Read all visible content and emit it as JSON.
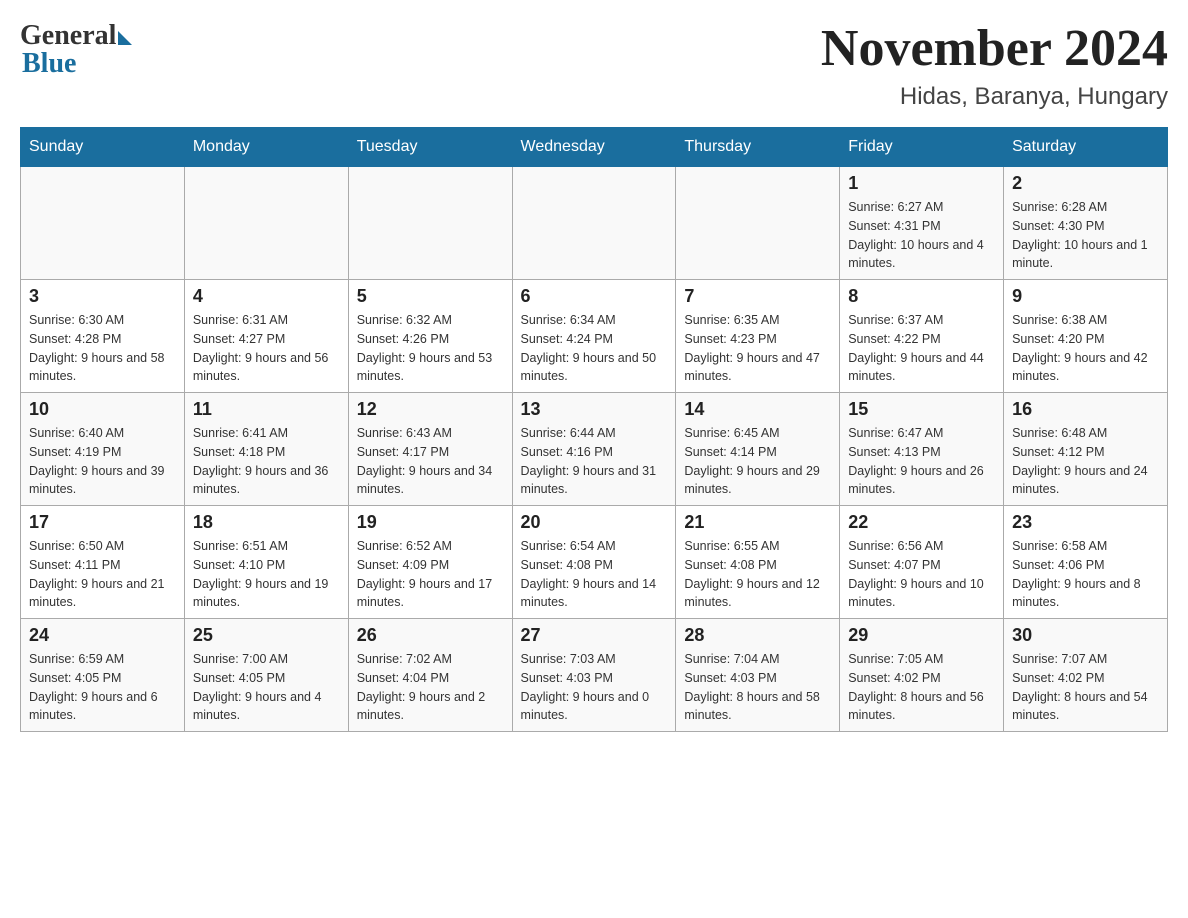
{
  "header": {
    "month_title": "November 2024",
    "location": "Hidas, Baranya, Hungary"
  },
  "days_of_week": [
    "Sunday",
    "Monday",
    "Tuesday",
    "Wednesday",
    "Thursday",
    "Friday",
    "Saturday"
  ],
  "weeks": [
    [
      {
        "day": "",
        "sunrise": "",
        "sunset": "",
        "daylight": ""
      },
      {
        "day": "",
        "sunrise": "",
        "sunset": "",
        "daylight": ""
      },
      {
        "day": "",
        "sunrise": "",
        "sunset": "",
        "daylight": ""
      },
      {
        "day": "",
        "sunrise": "",
        "sunset": "",
        "daylight": ""
      },
      {
        "day": "",
        "sunrise": "",
        "sunset": "",
        "daylight": ""
      },
      {
        "day": "1",
        "sunrise": "Sunrise: 6:27 AM",
        "sunset": "Sunset: 4:31 PM",
        "daylight": "Daylight: 10 hours and 4 minutes."
      },
      {
        "day": "2",
        "sunrise": "Sunrise: 6:28 AM",
        "sunset": "Sunset: 4:30 PM",
        "daylight": "Daylight: 10 hours and 1 minute."
      }
    ],
    [
      {
        "day": "3",
        "sunrise": "Sunrise: 6:30 AM",
        "sunset": "Sunset: 4:28 PM",
        "daylight": "Daylight: 9 hours and 58 minutes."
      },
      {
        "day": "4",
        "sunrise": "Sunrise: 6:31 AM",
        "sunset": "Sunset: 4:27 PM",
        "daylight": "Daylight: 9 hours and 56 minutes."
      },
      {
        "day": "5",
        "sunrise": "Sunrise: 6:32 AM",
        "sunset": "Sunset: 4:26 PM",
        "daylight": "Daylight: 9 hours and 53 minutes."
      },
      {
        "day": "6",
        "sunrise": "Sunrise: 6:34 AM",
        "sunset": "Sunset: 4:24 PM",
        "daylight": "Daylight: 9 hours and 50 minutes."
      },
      {
        "day": "7",
        "sunrise": "Sunrise: 6:35 AM",
        "sunset": "Sunset: 4:23 PM",
        "daylight": "Daylight: 9 hours and 47 minutes."
      },
      {
        "day": "8",
        "sunrise": "Sunrise: 6:37 AM",
        "sunset": "Sunset: 4:22 PM",
        "daylight": "Daylight: 9 hours and 44 minutes."
      },
      {
        "day": "9",
        "sunrise": "Sunrise: 6:38 AM",
        "sunset": "Sunset: 4:20 PM",
        "daylight": "Daylight: 9 hours and 42 minutes."
      }
    ],
    [
      {
        "day": "10",
        "sunrise": "Sunrise: 6:40 AM",
        "sunset": "Sunset: 4:19 PM",
        "daylight": "Daylight: 9 hours and 39 minutes."
      },
      {
        "day": "11",
        "sunrise": "Sunrise: 6:41 AM",
        "sunset": "Sunset: 4:18 PM",
        "daylight": "Daylight: 9 hours and 36 minutes."
      },
      {
        "day": "12",
        "sunrise": "Sunrise: 6:43 AM",
        "sunset": "Sunset: 4:17 PM",
        "daylight": "Daylight: 9 hours and 34 minutes."
      },
      {
        "day": "13",
        "sunrise": "Sunrise: 6:44 AM",
        "sunset": "Sunset: 4:16 PM",
        "daylight": "Daylight: 9 hours and 31 minutes."
      },
      {
        "day": "14",
        "sunrise": "Sunrise: 6:45 AM",
        "sunset": "Sunset: 4:14 PM",
        "daylight": "Daylight: 9 hours and 29 minutes."
      },
      {
        "day": "15",
        "sunrise": "Sunrise: 6:47 AM",
        "sunset": "Sunset: 4:13 PM",
        "daylight": "Daylight: 9 hours and 26 minutes."
      },
      {
        "day": "16",
        "sunrise": "Sunrise: 6:48 AM",
        "sunset": "Sunset: 4:12 PM",
        "daylight": "Daylight: 9 hours and 24 minutes."
      }
    ],
    [
      {
        "day": "17",
        "sunrise": "Sunrise: 6:50 AM",
        "sunset": "Sunset: 4:11 PM",
        "daylight": "Daylight: 9 hours and 21 minutes."
      },
      {
        "day": "18",
        "sunrise": "Sunrise: 6:51 AM",
        "sunset": "Sunset: 4:10 PM",
        "daylight": "Daylight: 9 hours and 19 minutes."
      },
      {
        "day": "19",
        "sunrise": "Sunrise: 6:52 AM",
        "sunset": "Sunset: 4:09 PM",
        "daylight": "Daylight: 9 hours and 17 minutes."
      },
      {
        "day": "20",
        "sunrise": "Sunrise: 6:54 AM",
        "sunset": "Sunset: 4:08 PM",
        "daylight": "Daylight: 9 hours and 14 minutes."
      },
      {
        "day": "21",
        "sunrise": "Sunrise: 6:55 AM",
        "sunset": "Sunset: 4:08 PM",
        "daylight": "Daylight: 9 hours and 12 minutes."
      },
      {
        "day": "22",
        "sunrise": "Sunrise: 6:56 AM",
        "sunset": "Sunset: 4:07 PM",
        "daylight": "Daylight: 9 hours and 10 minutes."
      },
      {
        "day": "23",
        "sunrise": "Sunrise: 6:58 AM",
        "sunset": "Sunset: 4:06 PM",
        "daylight": "Daylight: 9 hours and 8 minutes."
      }
    ],
    [
      {
        "day": "24",
        "sunrise": "Sunrise: 6:59 AM",
        "sunset": "Sunset: 4:05 PM",
        "daylight": "Daylight: 9 hours and 6 minutes."
      },
      {
        "day": "25",
        "sunrise": "Sunrise: 7:00 AM",
        "sunset": "Sunset: 4:05 PM",
        "daylight": "Daylight: 9 hours and 4 minutes."
      },
      {
        "day": "26",
        "sunrise": "Sunrise: 7:02 AM",
        "sunset": "Sunset: 4:04 PM",
        "daylight": "Daylight: 9 hours and 2 minutes."
      },
      {
        "day": "27",
        "sunrise": "Sunrise: 7:03 AM",
        "sunset": "Sunset: 4:03 PM",
        "daylight": "Daylight: 9 hours and 0 minutes."
      },
      {
        "day": "28",
        "sunrise": "Sunrise: 7:04 AM",
        "sunset": "Sunset: 4:03 PM",
        "daylight": "Daylight: 8 hours and 58 minutes."
      },
      {
        "day": "29",
        "sunrise": "Sunrise: 7:05 AM",
        "sunset": "Sunset: 4:02 PM",
        "daylight": "Daylight: 8 hours and 56 minutes."
      },
      {
        "day": "30",
        "sunrise": "Sunrise: 7:07 AM",
        "sunset": "Sunset: 4:02 PM",
        "daylight": "Daylight: 8 hours and 54 minutes."
      }
    ]
  ]
}
